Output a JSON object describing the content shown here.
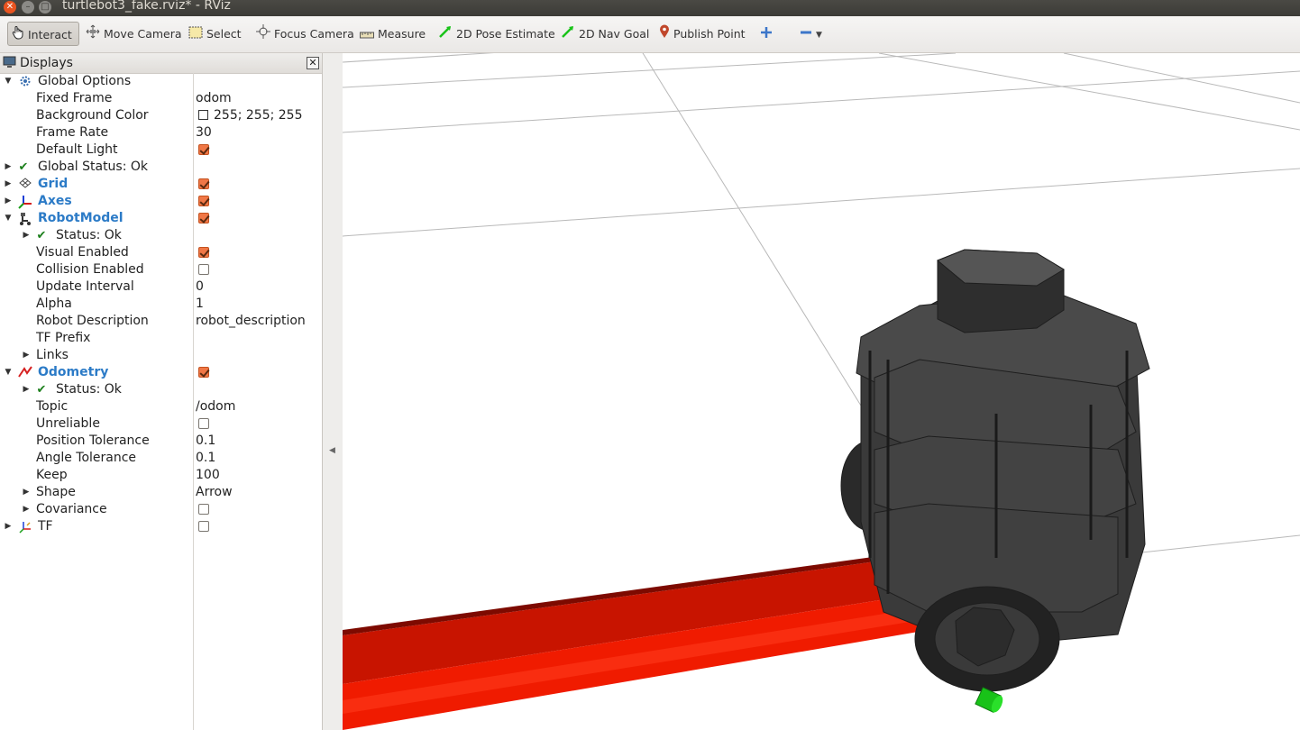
{
  "window": {
    "title": "turtlebot3_fake.rviz* - RViz"
  },
  "toolbar": {
    "interact": "Interact",
    "move_camera": "Move Camera",
    "select": "Select",
    "focus_camera": "Focus Camera",
    "measure": "Measure",
    "pose_estimate": "2D Pose Estimate",
    "nav_goal": "2D Nav Goal",
    "publish_point": "Publish Point"
  },
  "displays": {
    "title": "Displays",
    "rows": [
      {
        "label": "Global Options"
      },
      {
        "label": "Fixed Frame",
        "value": "odom"
      },
      {
        "label": "Background Color",
        "value": "255; 255; 255"
      },
      {
        "label": "Frame Rate",
        "value": "30"
      },
      {
        "label": "Default Light",
        "checked": true
      },
      {
        "label": "Global Status: Ok"
      },
      {
        "label": "Grid",
        "checked": true
      },
      {
        "label": "Axes",
        "checked": true
      },
      {
        "label": "RobotModel",
        "checked": true
      },
      {
        "label": "Status: Ok"
      },
      {
        "label": "Visual Enabled",
        "checked": true
      },
      {
        "label": "Collision Enabled",
        "checked": false
      },
      {
        "label": "Update Interval",
        "value": "0"
      },
      {
        "label": "Alpha",
        "value": "1"
      },
      {
        "label": "Robot Description",
        "value": "robot_description"
      },
      {
        "label": "TF Prefix",
        "value": ""
      },
      {
        "label": "Links"
      },
      {
        "label": "Odometry",
        "checked": true
      },
      {
        "label": "Status: Ok"
      },
      {
        "label": "Topic",
        "value": "/odom"
      },
      {
        "label": "Unreliable",
        "checked": false
      },
      {
        "label": "Position Tolerance",
        "value": "0.1"
      },
      {
        "label": "Angle Tolerance",
        "value": "0.1"
      },
      {
        "label": "Keep",
        "value": "100"
      },
      {
        "label": "Shape",
        "value": "Arrow"
      },
      {
        "label": "Covariance",
        "checked": false
      },
      {
        "label": "TF",
        "checked": false
      }
    ]
  },
  "colors": {
    "accent": "#f07746",
    "link_blue": "#2c7bc7",
    "odometry_arrow": "#f01b00",
    "robot_body": "#3a3a3a"
  }
}
